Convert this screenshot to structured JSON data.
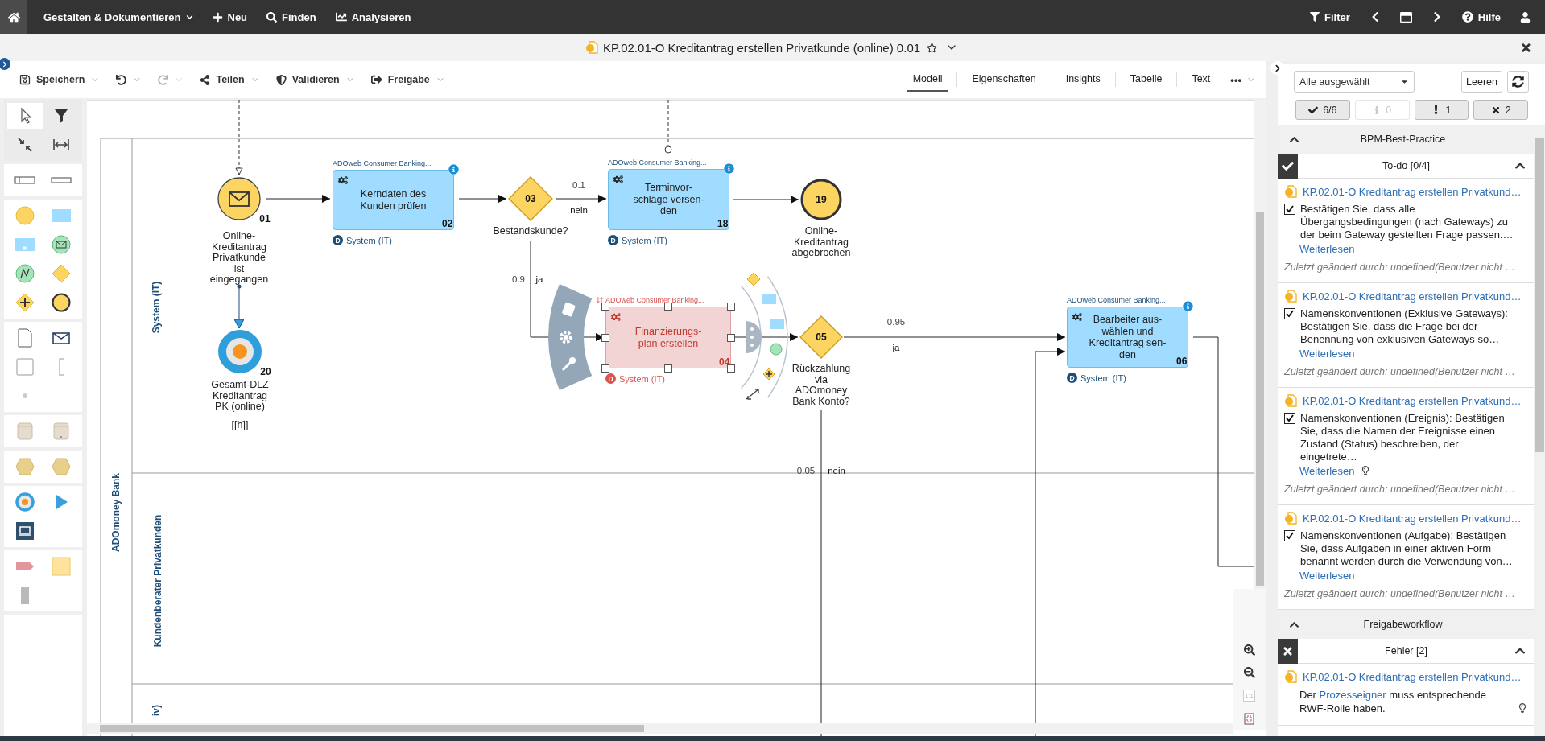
{
  "nav": {
    "items": [
      {
        "kind": "menu",
        "label": "Gestalten & Dokumentieren"
      },
      {
        "kind": "new",
        "label": "Neu"
      },
      {
        "kind": "search",
        "label": "Finden"
      },
      {
        "kind": "analyze",
        "label": "Analysieren"
      }
    ],
    "tools": [
      {
        "kind": "filter",
        "label": "Filter"
      },
      {
        "kind": "back"
      },
      {
        "kind": "window"
      },
      {
        "kind": "forward"
      },
      {
        "kind": "help",
        "label": "Hilfe"
      },
      {
        "kind": "user"
      }
    ]
  },
  "document": {
    "title": "KP.02.01-O Kreditantrag erstellen Privatkunde (online) 0.01",
    "favorite": false
  },
  "toolbar": {
    "actions": [
      {
        "kind": "save",
        "label": "Speichern",
        "disabled": false
      },
      {
        "kind": "undo",
        "disabled": false
      },
      {
        "kind": "redo",
        "disabled": true
      },
      {
        "kind": "share",
        "label": "Teilen",
        "disabled": false
      },
      {
        "kind": "validate",
        "label": "Validieren",
        "disabled": false
      },
      {
        "kind": "release",
        "label": "Freigabe",
        "disabled": false
      }
    ],
    "views": [
      {
        "label": "Modell",
        "selected": true
      },
      {
        "label": "Eigenschaften",
        "selected": false
      },
      {
        "label": "Insights",
        "selected": false
      },
      {
        "label": "Tabelle",
        "selected": false
      },
      {
        "label": "Text",
        "selected": false
      }
    ],
    "more": "•••"
  },
  "diagram": {
    "pool": "ADOmoney Bank",
    "lanes": [
      {
        "label": "System (IT)"
      },
      {
        "label": "Kundenberater Privatkunden"
      },
      {
        "label": "iv)"
      }
    ],
    "nodes": [
      {
        "kind": "start_message",
        "number": "01",
        "label": "Online-Kreditantrag Privatkunde ist eingegangen"
      },
      {
        "kind": "kpi",
        "number": "20",
        "label": "Gesamt-DLZ Kreditantrag PK (online)",
        "value": "[[h]]"
      },
      {
        "kind": "task",
        "number": "02",
        "label": "Kerndaten des Kunden prüfen",
        "header": "ADOweb Consumer Banking...",
        "badge": "D",
        "performer": "System (IT)",
        "info": true,
        "selected": false
      },
      {
        "kind": "gateway",
        "number": "03",
        "label": "Bestandskunde?"
      },
      {
        "kind": "task",
        "number": "18",
        "label": "Terminvor-schläge versen-den",
        "header": "ADOweb Consumer Banking...",
        "badge": "D",
        "performer": "System (IT)",
        "info": true,
        "selected": false
      },
      {
        "kind": "end",
        "number": "19",
        "label": "Online-Kreditantrag abgebrochen"
      },
      {
        "kind": "task",
        "number": "04",
        "label": "Finanzierungs-plan erstellen",
        "header": "ADOweb Consumer Banking...",
        "badge": "D",
        "performer": "System (IT)",
        "info": false,
        "selected": true
      },
      {
        "kind": "gateway",
        "number": "05",
        "label": "Rückzahlung via ADOmoney Bank Konto?"
      },
      {
        "kind": "task",
        "number": "06",
        "label": "Bearbeiter aus-wählen und Kreditantrag sen-den",
        "header": "ADOweb Consumer Banking...",
        "badge": "D",
        "performer": "System (IT)",
        "info": true,
        "selected": false
      }
    ],
    "edges": [
      {
        "kind": "trigger"
      },
      {
        "kind": "association"
      },
      {
        "kind": "flow"
      },
      {
        "kind": "flow"
      },
      {
        "kind": "flow",
        "probability": "0.1",
        "condition": "nein"
      },
      {
        "kind": "flow"
      },
      {
        "kind": "flow",
        "probability": "0.9",
        "condition": "ja"
      },
      {
        "kind": "flow"
      },
      {
        "kind": "flow",
        "probability": "0.95",
        "condition": "ja"
      },
      {
        "kind": "flow",
        "probability": "0.05",
        "condition": "nein"
      },
      {
        "kind": "flow"
      },
      {
        "kind": "flow"
      },
      {
        "kind": "reference"
      }
    ],
    "zoom": {
      "actual_size": "1:1",
      "actual_size_disabled": true
    }
  },
  "validation": {
    "scope": "Alle ausgewählt",
    "clear": "Leeren",
    "filters": [
      {
        "kind": "ok",
        "count": "6/6",
        "disabled": false
      },
      {
        "kind": "info",
        "count": "0",
        "disabled": true
      },
      {
        "kind": "warning",
        "count": "1",
        "disabled": false
      },
      {
        "kind": "error",
        "count": "2",
        "disabled": false
      }
    ],
    "sections": [
      {
        "title": "BPM-Best-Practice",
        "expanded": true,
        "groups": [
          {
            "kind": "todo",
            "title": "To-do [0/4]",
            "expanded": true,
            "items": [
              {
                "kind": "check",
                "model": "KP.02.01-O Kreditantrag erstellen Privatkund…",
                "checked": true,
                "text": "Bestätigen Sie, dass alle Übergangsbedingungen (nach Gateways) zu der beim Gateway gestellten Frage passen.…",
                "more": "Weiterlesen",
                "hint": false,
                "changed": "Zuletzt geändert durch: undefined(Benutzer nicht …"
              },
              {
                "kind": "check",
                "model": "KP.02.01-O Kreditantrag erstellen Privatkund…",
                "checked": true,
                "text": "Namenskonventionen (Exklusive Gateways): Bestätigen Sie, dass die Frage bei der Benennung von exklusiven Gateways so…",
                "more": "Weiterlesen",
                "hint": false,
                "changed": "Zuletzt geändert durch: undefined(Benutzer nicht …"
              },
              {
                "kind": "check",
                "model": "KP.02.01-O Kreditantrag erstellen Privatkund…",
                "checked": true,
                "text": "Namenskonventionen (Ereignis): Bestätigen Sie, dass die Namen der Ereignisse einen Zustand (Status) beschreiben, der eingetrete…",
                "more": "Weiterlesen",
                "hint": true,
                "changed": "Zuletzt geändert durch: undefined(Benutzer nicht …"
              },
              {
                "kind": "check",
                "model": "KP.02.01-O Kreditantrag erstellen Privatkund…",
                "checked": true,
                "text": "Namenskonventionen (Aufgabe): Bestätigen Sie, dass Aufgaben in einer aktiven Form benannt werden durch die Verwendung von…",
                "more": "Weiterlesen",
                "hint": false,
                "changed": "Zuletzt geändert durch: undefined(Benutzer nicht …"
              }
            ]
          }
        ]
      },
      {
        "title": "Freigabeworkflow",
        "expanded": true,
        "groups": [
          {
            "kind": "error",
            "title": "Fehler [2]",
            "expanded": true,
            "items": [
              {
                "kind": "message",
                "model": "KP.02.01-O Kreditantrag erstellen Privatkund…",
                "text_before": "Der",
                "link": "Prozesseigner",
                "text_after": "muss entsprechende RWF-Rolle haben.",
                "hint": true
              }
            ]
          }
        ]
      }
    ]
  }
}
